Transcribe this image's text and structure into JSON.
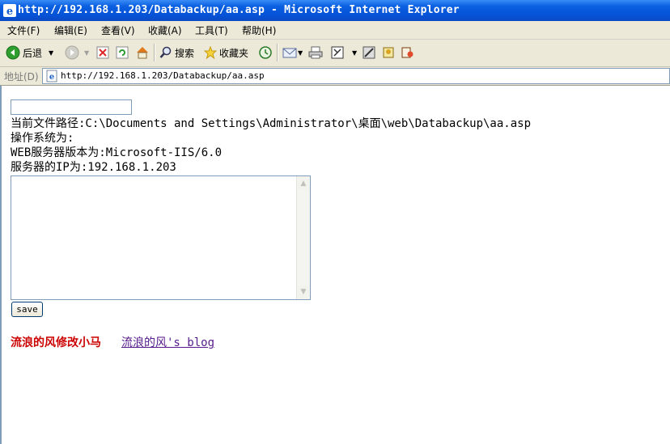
{
  "window": {
    "title": "http://192.168.1.203/Databackup/aa.asp - Microsoft Internet Explorer"
  },
  "menu": {
    "items": [
      "文件(F)",
      "编辑(E)",
      "查看(V)",
      "收藏(A)",
      "工具(T)",
      "帮助(H)"
    ]
  },
  "toolbar": {
    "back_label": "后退",
    "search_label": "搜索",
    "favorites_label": "收藏夹"
  },
  "address": {
    "label": "地址(D)",
    "url": "http://192.168.1.203/Databackup/aa.asp"
  },
  "page": {
    "path_input_value": "",
    "current_path": "当前文件路径:C:\\Documents and Settings\\Administrator\\桌面\\web\\Databackup\\aa.asp",
    "os_line": "操作系统为:",
    "web_server_line": "WEB服务器版本为:Microsoft-IIS/6.0",
    "server_ip_line": "服务器的IP为:192.168.1.203",
    "textarea_value": "",
    "save_label": "save",
    "brand_text": "流浪的风修改小马",
    "blog_link_text": "流浪的风's blog"
  },
  "colors": {
    "titlebar": "#0653d8",
    "chrome": "#ece9d8",
    "brand_red": "#cc0000",
    "visited_link": "#551a8b"
  }
}
